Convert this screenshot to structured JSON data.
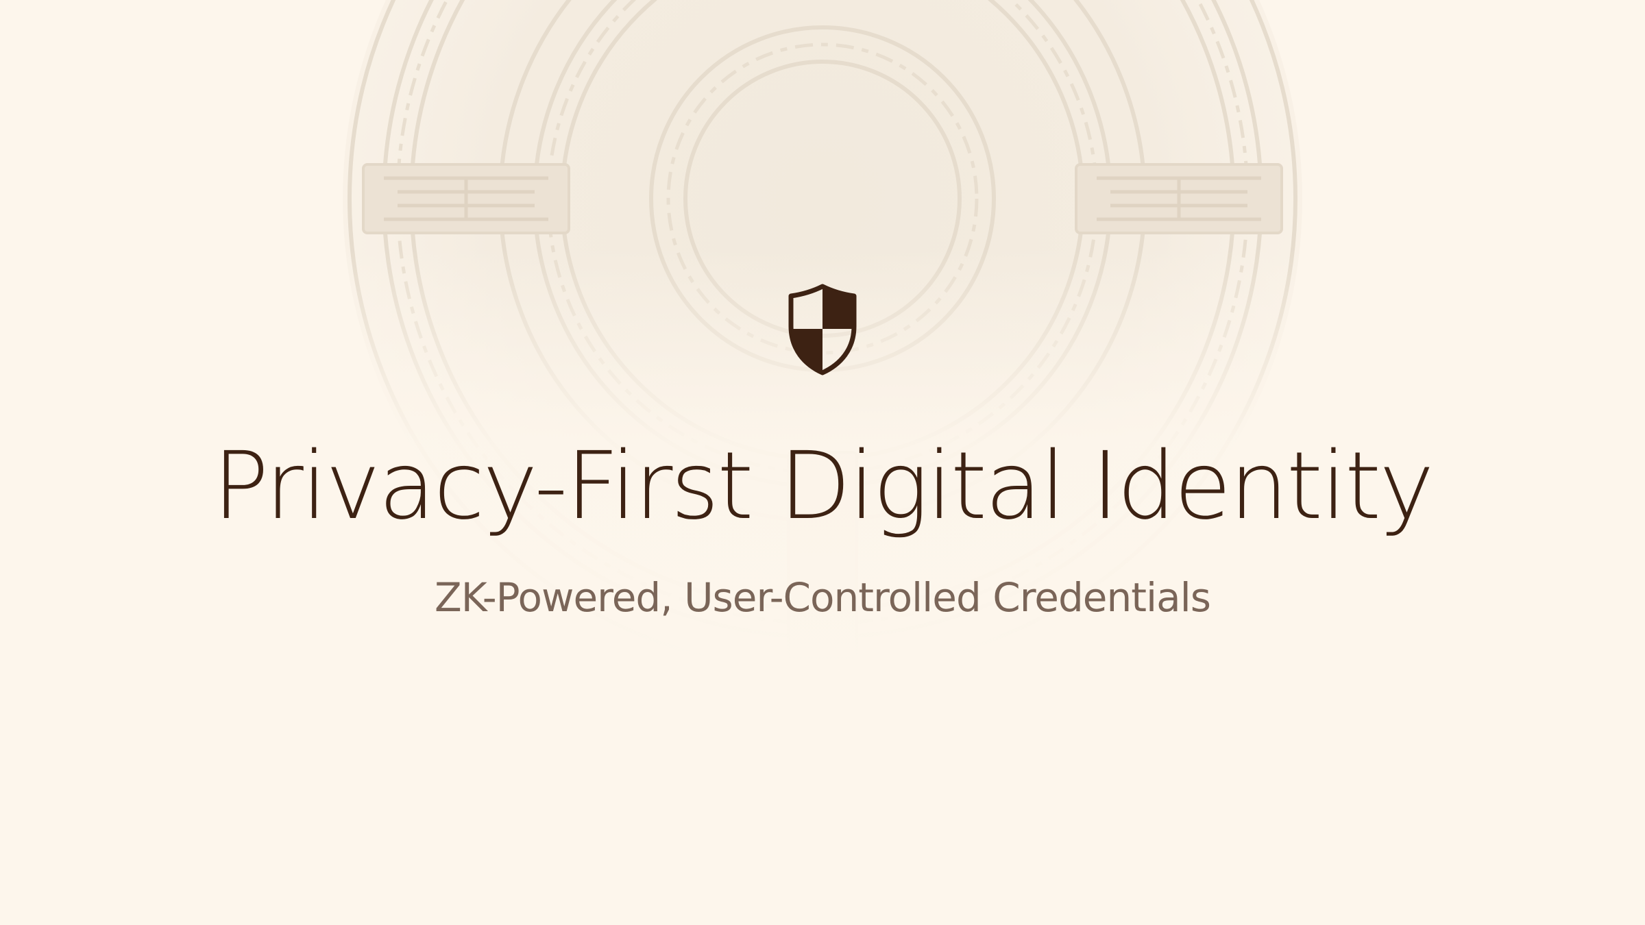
{
  "slide": {
    "title": "Privacy-First Digital Identity",
    "subtitle": "ZK-Powered, User-Controlled Credentials"
  },
  "icons": {
    "hero": "shield-icon",
    "background": "circular-meander-emblem"
  },
  "colors": {
    "background": "#fdf6ec",
    "title": "#3d2213",
    "subtitle": "#7a6558",
    "icon": "#3d2213",
    "emblem": "#efe5d8"
  }
}
